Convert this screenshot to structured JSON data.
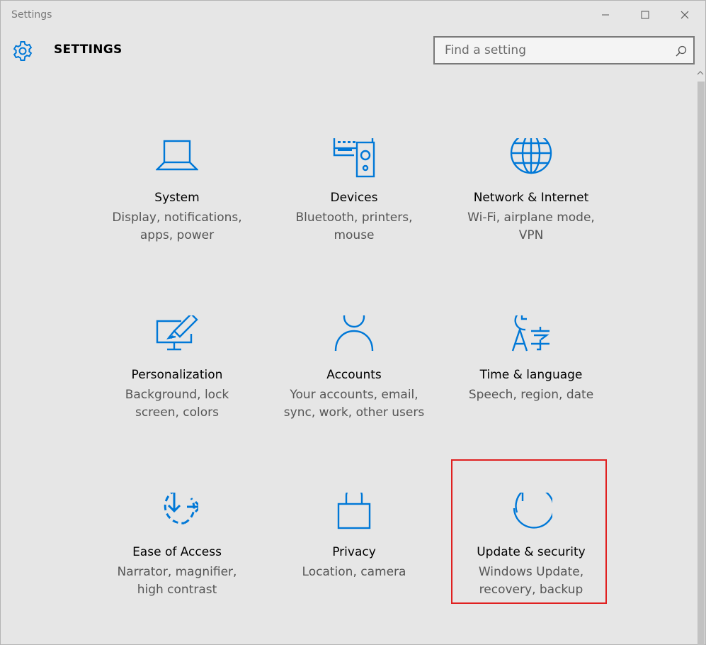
{
  "window": {
    "title": "Settings"
  },
  "header": {
    "title": "SETTINGS",
    "icon": "gear-icon"
  },
  "search": {
    "placeholder": "Find a setting",
    "icon": "search-icon"
  },
  "accent_color": "#0078d7",
  "highlight_color": "#e02020",
  "tiles": [
    {
      "id": "system",
      "icon": "laptop-icon",
      "label": "System",
      "desc": "Display, notifications,\napps, power"
    },
    {
      "id": "devices",
      "icon": "keyboard-speaker-icon",
      "label": "Devices",
      "desc": "Bluetooth, printers,\nmouse"
    },
    {
      "id": "network",
      "icon": "globe-icon",
      "label": "Network & Internet",
      "desc": "Wi-Fi, airplane mode,\nVPN"
    },
    {
      "id": "personalization",
      "icon": "monitor-brush-icon",
      "label": "Personalization",
      "desc": "Background, lock\nscreen, colors"
    },
    {
      "id": "accounts",
      "icon": "person-icon",
      "label": "Accounts",
      "desc": "Your accounts, email,\nsync, work, other users"
    },
    {
      "id": "time-language",
      "icon": "clock-language-icon",
      "label": "Time & language",
      "desc": "Speech, region, date"
    },
    {
      "id": "ease-of-access",
      "icon": "ease-of-access-icon",
      "label": "Ease of Access",
      "desc": "Narrator, magnifier,\nhigh contrast"
    },
    {
      "id": "privacy",
      "icon": "lock-icon",
      "label": "Privacy",
      "desc": "Location, camera"
    },
    {
      "id": "update-security",
      "icon": "refresh-icon",
      "label": "Update & security",
      "desc": "Windows Update,\nrecovery, backup"
    }
  ]
}
